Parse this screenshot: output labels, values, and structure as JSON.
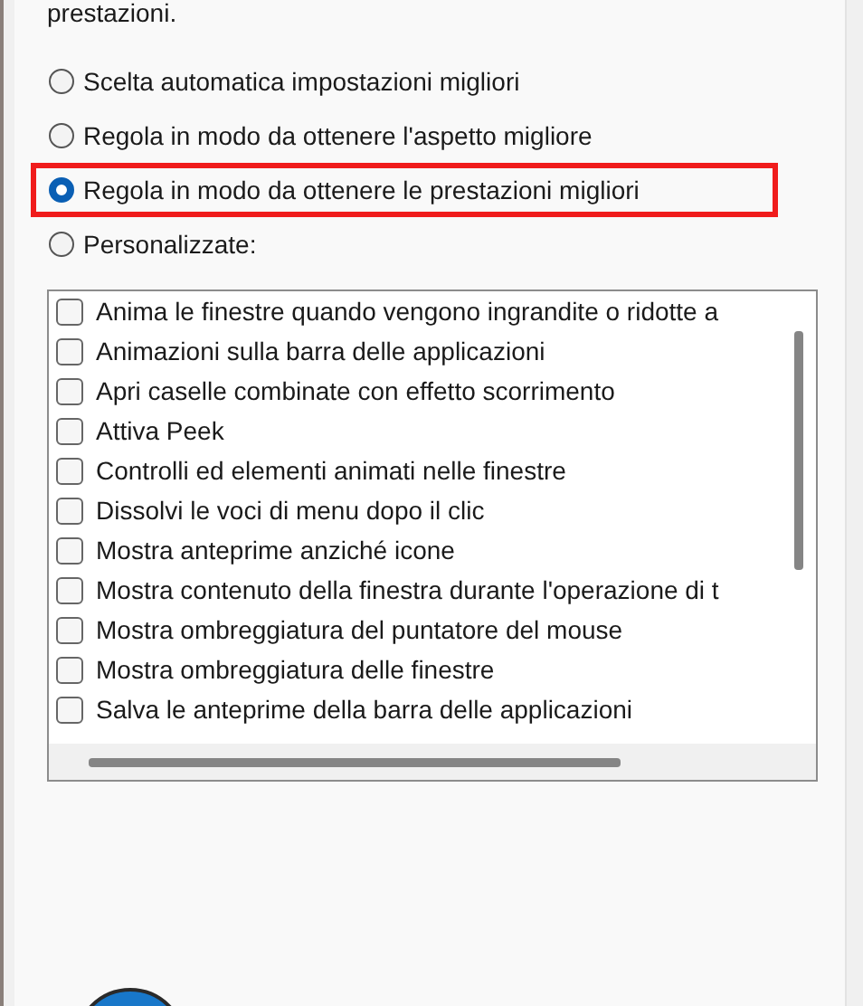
{
  "intro": "prestazioni.",
  "options": [
    {
      "label": "Scelta automatica impostazioni migliori",
      "selected": false,
      "highlighted": false
    },
    {
      "label": "Regola in modo da ottenere l'aspetto migliore",
      "selected": false,
      "highlighted": false
    },
    {
      "label": "Regola in modo da ottenere le prestazioni migliori",
      "selected": true,
      "highlighted": true
    },
    {
      "label": "Personalizzate:",
      "selected": false,
      "highlighted": false
    }
  ],
  "settings": [
    {
      "label": "Anima le finestre quando vengono ingrandite o ridotte a",
      "checked": false
    },
    {
      "label": "Animazioni sulla barra delle applicazioni",
      "checked": false
    },
    {
      "label": "Apri caselle combinate con effetto scorrimento",
      "checked": false
    },
    {
      "label": "Attiva Peek",
      "checked": false
    },
    {
      "label": "Controlli ed elementi animati nelle finestre",
      "checked": false
    },
    {
      "label": "Dissolvi le voci di menu dopo il clic",
      "checked": false
    },
    {
      "label": "Mostra anteprime anziché icone",
      "checked": false
    },
    {
      "label": "Mostra contenuto della finestra durante l'operazione di t",
      "checked": false
    },
    {
      "label": "Mostra ombreggiatura del puntatore del mouse",
      "checked": false
    },
    {
      "label": "Mostra ombreggiatura delle finestre",
      "checked": false
    },
    {
      "label": "Salva le anteprime della barra delle applicazioni",
      "checked": false
    }
  ]
}
